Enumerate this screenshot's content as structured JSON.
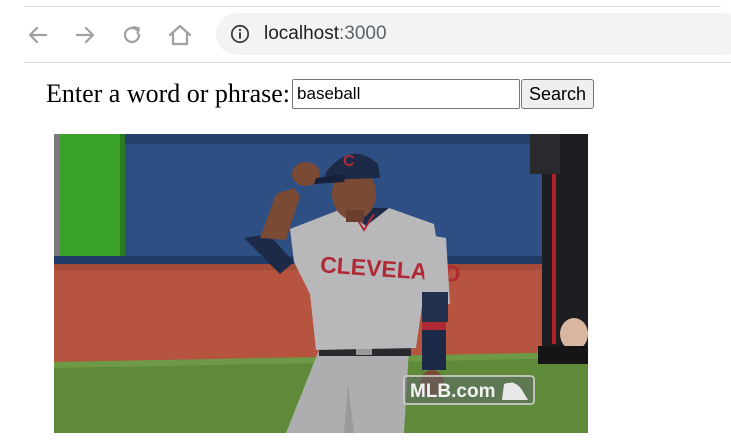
{
  "browser": {
    "url_host": "localhost",
    "url_port": ":3000",
    "icons": [
      "back-arrow-icon",
      "forward-arrow-icon",
      "reload-icon",
      "home-icon",
      "info-icon"
    ]
  },
  "form": {
    "prompt": "Enter a word or phrase:",
    "input_value": "baseball",
    "button_label": "Search"
  },
  "result_image": {
    "jersey_text": "CLEVELAND",
    "watermark": "MLB.com"
  },
  "colors": {
    "outfield_wall": "#2e4f84",
    "green_panel": "#3aa22a",
    "warning_track": "#b65440",
    "grass": "#5f8a3a",
    "uniform": "#b5b5b7",
    "jersey_lettering": "#b02a36",
    "cap_navy": "#1c2a48"
  }
}
